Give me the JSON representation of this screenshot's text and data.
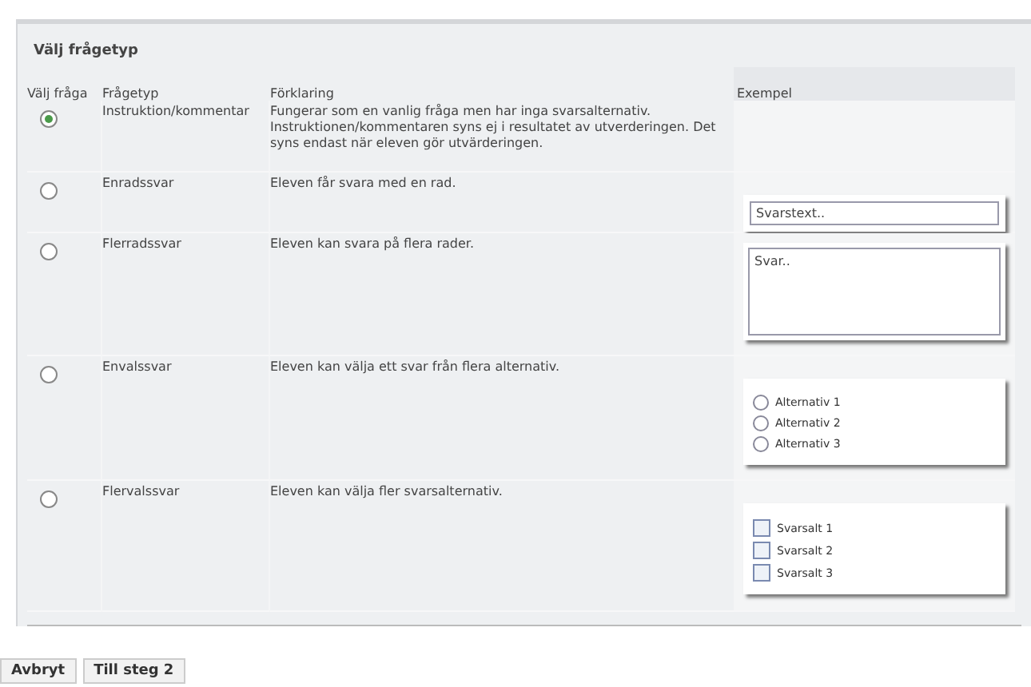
{
  "panel": {
    "legend": "Välj frågetyp"
  },
  "table": {
    "columns": [
      "Välj fråga",
      "Frågetyp",
      "Förklaring",
      "Exempel"
    ],
    "rows": [
      {
        "selected": true,
        "type": "Instruktion/kommentar",
        "explanation": "Fungerar som en vanlig fråga men har inga svarsalternativ. Instruktionen/kommentaren syns ej i resultatet av utverderingen. Det syns endast när eleven gör utvärderingen.",
        "example": {
          "kind": "none"
        }
      },
      {
        "selected": false,
        "type": "Enradssvar",
        "explanation": "Eleven får svara med en rad.",
        "example": {
          "kind": "textfield",
          "placeholder": "Svarstext.."
        }
      },
      {
        "selected": false,
        "type": "Flerradssvar",
        "explanation": "Eleven kan svara på flera rader.",
        "example": {
          "kind": "textarea",
          "placeholder": "Svar.."
        }
      },
      {
        "selected": false,
        "type": "Envalssvar",
        "explanation": "Eleven kan välja ett svar från flera alternativ.",
        "example": {
          "kind": "radios",
          "options": [
            {
              "label": "Alternativ 1",
              "selected": false
            },
            {
              "label": "Alternativ 2",
              "selected": false
            },
            {
              "label": "Alternativ 3",
              "selected": false
            }
          ]
        }
      },
      {
        "selected": false,
        "type": "Flervalssvar",
        "explanation": "Eleven kan välja fler svarsalternativ.",
        "example": {
          "kind": "checkboxes",
          "options": [
            {
              "label": "Svarsalt 1",
              "checked": false
            },
            {
              "label": "Svarsalt 2",
              "checked": false
            },
            {
              "label": "Svarsalt 3",
              "checked": false
            }
          ]
        }
      }
    ]
  },
  "buttons": [
    "Avbryt",
    "Till steg 2"
  ]
}
